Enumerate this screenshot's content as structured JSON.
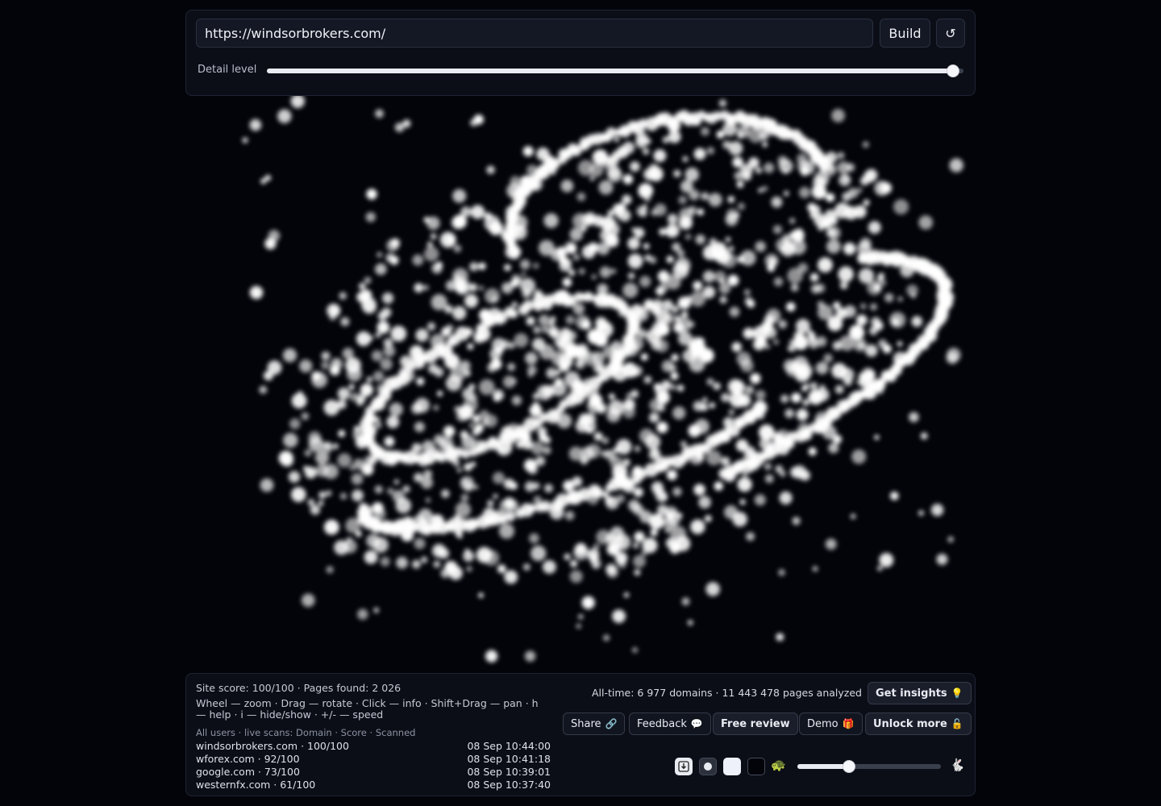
{
  "toolbar": {
    "url_value": "https://windsorbrokers.com/",
    "build_label": "Build",
    "reset_glyph": "↺",
    "detail_label": "Detail level",
    "detail_level": 0.985
  },
  "stats": {
    "site_score": "Site score: 100/100 · Pages found: 2 026",
    "help": "Wheel — zoom · Drag — rotate · Click — info · Shift+Drag — pan · h — help · i — hide/show · +/- — speed",
    "scans_header": "All users · live scans: Domain · Score · Scanned",
    "scans": [
      {
        "domain": "windsorbrokers.com · 100/100",
        "time": "08 Sep 10:44:00"
      },
      {
        "domain": "wforex.com · 92/100",
        "time": "08 Sep 10:41:18"
      },
      {
        "domain": "google.com · 73/100",
        "time": "08 Sep 10:39:01"
      },
      {
        "domain": "westernfx.com · 61/100",
        "time": "08 Sep 10:37:40"
      }
    ],
    "alltime": "All-time: 6 977 domains · 11 443 478 pages analyzed"
  },
  "actions": {
    "insights": "Get insights",
    "insights_emoji": "💡",
    "share": "Share",
    "share_emoji": "🔗",
    "feedback": "Feedback",
    "feedback_emoji": "💬",
    "free_review": "Free review",
    "demo": "Demo",
    "demo_emoji": "🎁",
    "unlock": "Unlock more",
    "unlock_emoji": "🔓"
  },
  "controls": {
    "turtle": "🐢",
    "rabbit": "🐇",
    "speed_level": 0.36,
    "icons": [
      "download-icon",
      "dot-icon",
      "light-theme-icon",
      "dark-theme-icon"
    ]
  },
  "colors": {
    "background": "#03040a",
    "particle": "#ffffff",
    "panel": "#0b0e16"
  }
}
